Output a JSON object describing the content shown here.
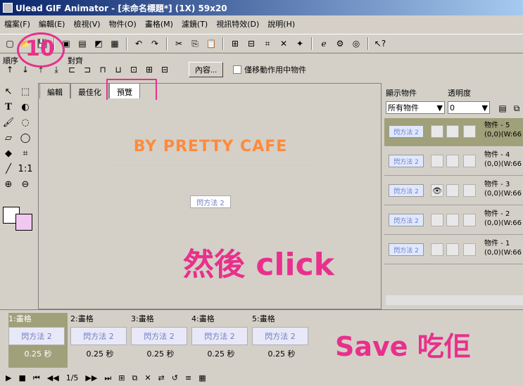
{
  "window": {
    "title": "Ulead GIF Animator - [未命名標題*] (1X) 59x20"
  },
  "menu": [
    "檔案(F)",
    "編輯(E)",
    "檢視(V)",
    "物件(O)",
    "畫格(M)",
    "濾鏡(T)",
    "視訊特效(D)",
    "說明(H)"
  ],
  "toolbar2": {
    "order_label": "順序",
    "align_label": "對齊",
    "content_button": "內容...",
    "move_only_checkbox": "僅移動作用中物件"
  },
  "tabs": [
    "編輯",
    "最佳化",
    "預覽"
  ],
  "canvas": {
    "preview_text": "BY   PRETTY CAFE",
    "small_object_text": "閃方法 2"
  },
  "annotations": {
    "step": "10",
    "then_click": "然後 click",
    "save_it": "Save 吃佢"
  },
  "objects_panel": {
    "display_label": "顯示物件",
    "opacity_label": "透明度",
    "display_value": "所有物件",
    "opacity_value": "0",
    "thumb_text": "閃方法 2",
    "objects": [
      {
        "name": "物件 - 5",
        "coords": "(0,0)(W:66"
      },
      {
        "name": "物件 - 4",
        "coords": "(0,0)(W:66"
      },
      {
        "name": "物件 - 3",
        "coords": "(0,0)(W:66"
      },
      {
        "name": "物件 - 2",
        "coords": "(0,0)(W:66"
      },
      {
        "name": "物件 - 1",
        "coords": "(0,0)(W:66"
      }
    ]
  },
  "frames": [
    {
      "label": "1:畫格",
      "delay": "0.25 秒",
      "thumb": "閃方法 2"
    },
    {
      "label": "2:畫格",
      "delay": "0.25 秒",
      "thumb": "閃方法 2"
    },
    {
      "label": "3:畫格",
      "delay": "0.25 秒",
      "thumb": "閃方法 2"
    },
    {
      "label": "4:畫格",
      "delay": "0.25 秒",
      "thumb": "閃方法 2"
    },
    {
      "label": "5:畫格",
      "delay": "0.25 秒",
      "thumb": "閃方法 2"
    }
  ],
  "playbar": {
    "counter": "1/5"
  },
  "colors": {
    "annotation": "#e8308c",
    "preview_text": "#ff8a3c",
    "selected": "#a0a07a",
    "titlebar": "#0a246a"
  }
}
